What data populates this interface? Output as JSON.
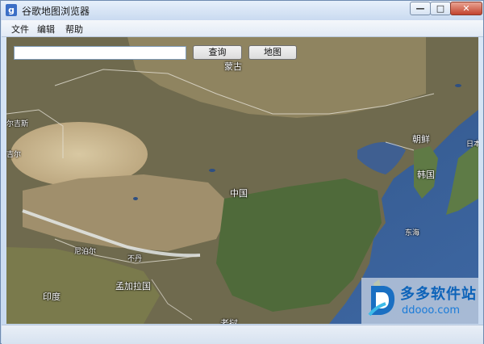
{
  "window": {
    "title": "谷歌地图浏览器",
    "app_icon_glyph": "g",
    "controls": {
      "minimize_glyph": "—",
      "maximize_glyph": "□",
      "close_glyph": "✕"
    }
  },
  "menu": [
    "文件",
    "编辑",
    "帮助"
  ],
  "toolbar": {
    "search_value": "",
    "query_label": "查询",
    "map_label": "地图"
  },
  "map_labels": {
    "mongolia": "蒙古",
    "kazakhstan_partial": "尔吉斯",
    "kazakhstan_partial2": "吉尔",
    "china": "中国",
    "north_korea": "朝鲜",
    "south_korea": "韩国",
    "japan_partial": "日本",
    "east_sea": "东海",
    "nepal": "尼泊尔",
    "bhutan": "不丹",
    "bangladesh": "孟加拉国",
    "india": "印度",
    "laos_partial": "老挝"
  },
  "watermark": {
    "brand": "多多软件站",
    "url": "ddooo.com"
  },
  "colors": {
    "accent": "#0d63b9",
    "title_bar": "#c9daf0"
  }
}
